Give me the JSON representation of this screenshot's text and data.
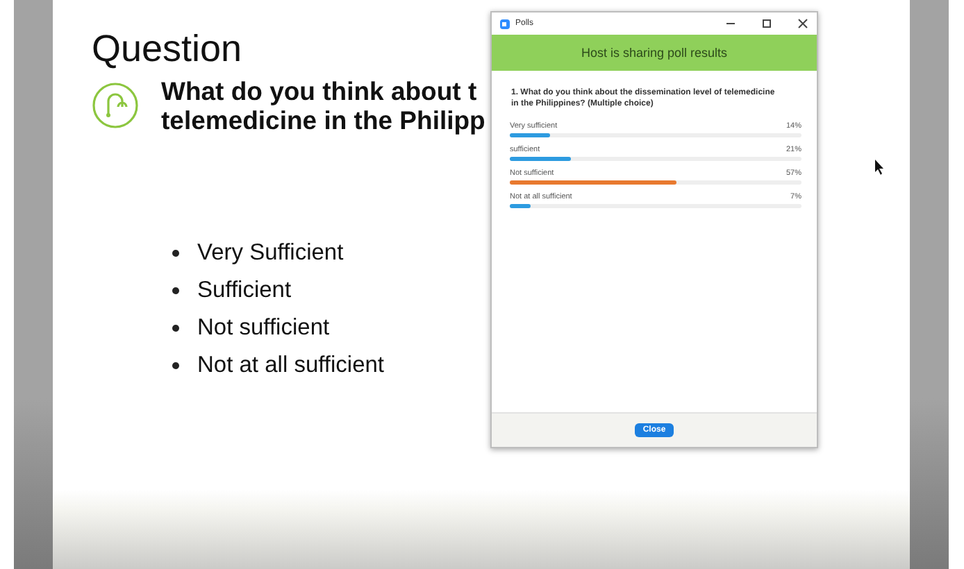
{
  "slide": {
    "title": "Question",
    "question_lines": [
      "What do you think about t",
      "telemedicine in the Philipp"
    ],
    "bullets": [
      "Very Sufficient",
      "Sufficient",
      "Not sufficient",
      "Not at all sufficient"
    ]
  },
  "poll_window": {
    "title": "Polls",
    "banner": "Host is sharing poll results",
    "question": "1. What do you think about the dissemination level of telemedicine in the Philippines? (Multiple choice)",
    "answers": [
      {
        "label": "Very sufficient",
        "reading": "14%",
        "level": 0.14,
        "color": "#2d9be0"
      },
      {
        "label": "sufficient",
        "reading": "21%",
        "level": 0.21,
        "color": "#2d9be0"
      },
      {
        "label": "Not sufficient",
        "reading": "57%",
        "level": 0.57,
        "color": "#e8792f"
      },
      {
        "label": "Not at all sufficient",
        "reading": "7%",
        "level": 0.07,
        "color": "#2d9be0"
      }
    ],
    "close_button": "Close"
  }
}
